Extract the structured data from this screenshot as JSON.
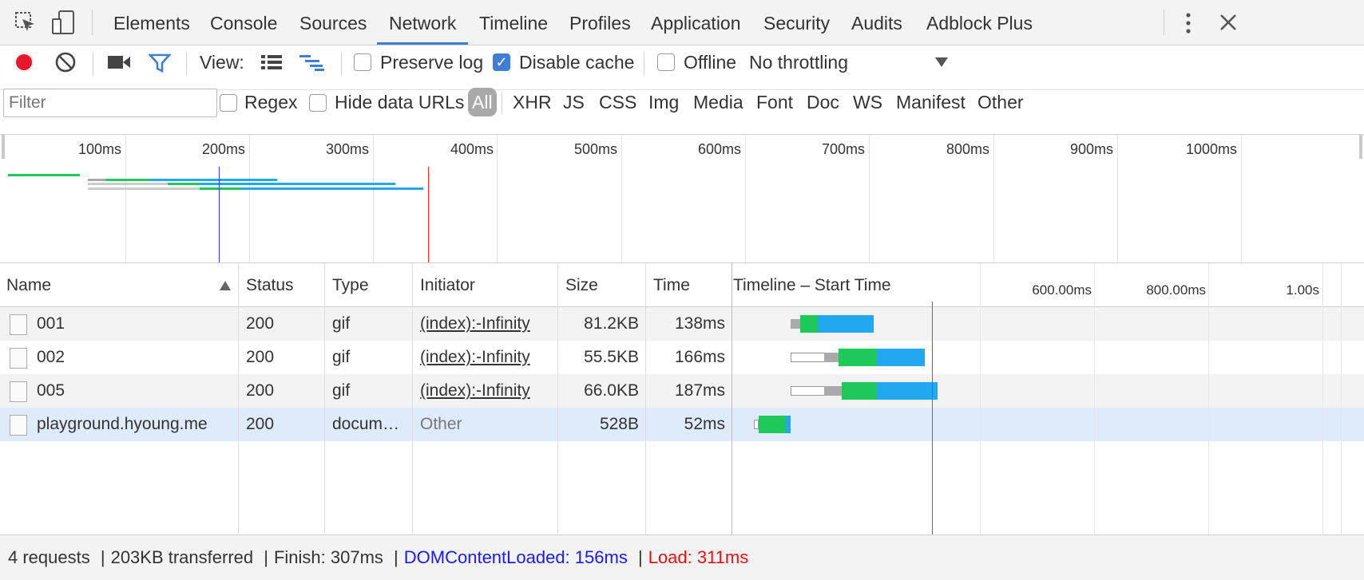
{
  "tabs": [
    "Elements",
    "Console",
    "Sources",
    "Network",
    "Timeline",
    "Profiles",
    "Application",
    "Security",
    "Audits",
    "Adblock Plus"
  ],
  "active_tab": "Network",
  "toolbar": {
    "view_label": "View:",
    "preserve_log": "Preserve log",
    "disable_cache": "Disable cache",
    "offline": "Offline",
    "throttling": "No throttling"
  },
  "filterbar": {
    "filter_placeholder": "Filter",
    "regex": "Regex",
    "hide_data_urls": "Hide data URLs",
    "types": [
      "All",
      "XHR",
      "JS",
      "CSS",
      "Img",
      "Media",
      "Font",
      "Doc",
      "WS",
      "Manifest",
      "Other"
    ]
  },
  "overview": {
    "ticks": [
      "100ms",
      "200ms",
      "300ms",
      "400ms",
      "500ms",
      "600ms",
      "700ms",
      "800ms",
      "900ms",
      "1000ms"
    ]
  },
  "table": {
    "headers": [
      "Name",
      "Status",
      "Type",
      "Initiator",
      "Size",
      "Time",
      "Timeline – Start Time"
    ],
    "timeline_ticks": [
      "600.00ms",
      "800.00ms",
      "1.00s"
    ],
    "rows": [
      {
        "name": "001",
        "status": "200",
        "type": "gif",
        "initiator": "(index):-Infinity",
        "size": "81.2KB",
        "time": "138ms"
      },
      {
        "name": "002",
        "status": "200",
        "type": "gif",
        "initiator": "(index):-Infinity",
        "size": "55.5KB",
        "time": "166ms"
      },
      {
        "name": "005",
        "status": "200",
        "type": "gif",
        "initiator": "(index):-Infinity",
        "size": "66.0KB",
        "time": "187ms"
      },
      {
        "name": "playground.hyoung.me",
        "status": "200",
        "type": "docum…",
        "initiator": "Other",
        "size": "528B",
        "time": "52ms"
      }
    ]
  },
  "status": {
    "requests": "4 requests",
    "transferred": "203KB transferred",
    "finish": "Finish: 307ms",
    "dom": "DOMContentLoaded: 156ms",
    "load": "Load: 311ms",
    "sep": "|"
  },
  "colors": {
    "accent": "#3f7ed5",
    "green": "#1ec85a",
    "blue": "#22a8ee",
    "dom_line": "#3d3dff",
    "load_line": "#ff2a2a",
    "selected_row": "#ddebfa"
  }
}
